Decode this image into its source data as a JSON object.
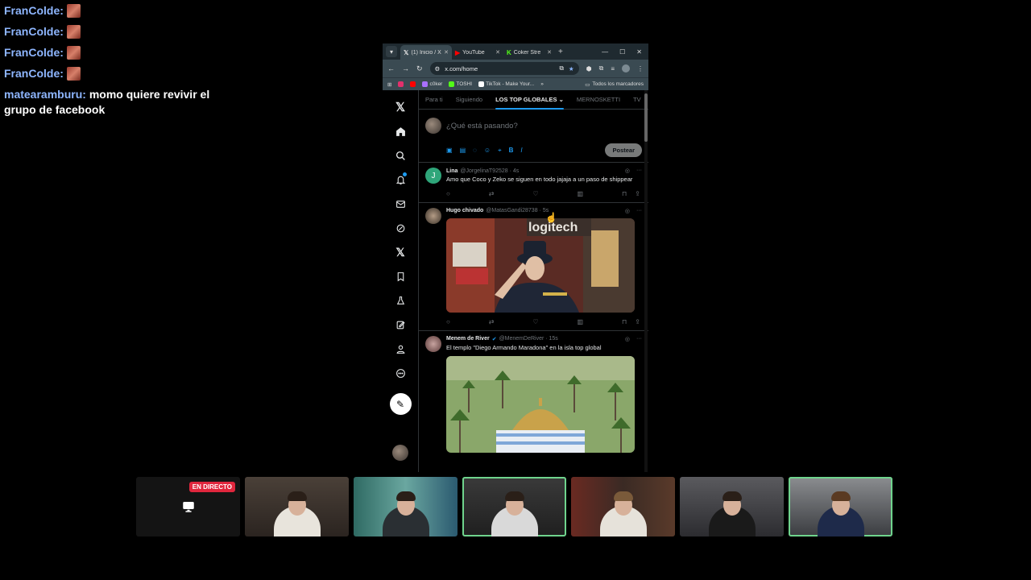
{
  "chat": {
    "messages": [
      {
        "user": "FranColde:",
        "text": ""
      },
      {
        "user": "FranColde:",
        "text": ""
      },
      {
        "user": "FranColde:",
        "text": ""
      },
      {
        "user": "FranColde:",
        "text": ""
      },
      {
        "user": "matearamburu:",
        "text": "momo quiere revivir el grupo de facebook"
      }
    ]
  },
  "browser": {
    "tabs": [
      {
        "label": "(1) Inicio / X",
        "icon": "x-logo-icon"
      },
      {
        "label": "YouTube",
        "icon": "youtube-icon"
      },
      {
        "label": "Coker Stre",
        "icon": "kick-icon"
      }
    ],
    "url": "x.com/home",
    "bookmarks": [
      {
        "label": "",
        "color": "#e1306c"
      },
      {
        "label": "",
        "color": "#ff0000"
      },
      {
        "label": "c0ker",
        "color": "#a970ff"
      },
      {
        "label": "TOSHI",
        "color": "#53fc18"
      },
      {
        "label": "TikTok - Make Your...",
        "color": "#ffffff"
      }
    ],
    "all_bookmarks": "Todos los marcadores"
  },
  "x": {
    "feed_tabs": [
      "Para ti",
      "Siguiendo",
      "LOS TOP GLOBALES",
      "MERNOSKETTI",
      "TV"
    ],
    "active_tab": "LOS TOP GLOBALES",
    "composer_placeholder": "¿Qué está pasando?",
    "post_button": "Postear",
    "accent": "#1d9bf0",
    "tweets": [
      {
        "name": "Lina",
        "handle": "@JorgelinaT92528 · 4s",
        "text": "Amo que Coco y Zeko se siguen en todo jajaja a un paso de shippear",
        "avatar_letter": "J",
        "avatar_color": "#2fa67a"
      },
      {
        "name": "Hugo chivado",
        "handle": "@MatasGandi28738 · 5s",
        "text": "",
        "media_caption": "logitech"
      },
      {
        "name": "Menem de River",
        "handle": "@MenemDeRiver · 15s",
        "text": "El templo \"Diego Armando Maradona\" en la isla top global"
      }
    ]
  },
  "stream": {
    "live_badge": "EN DIRECTO",
    "cam_count": 7
  }
}
